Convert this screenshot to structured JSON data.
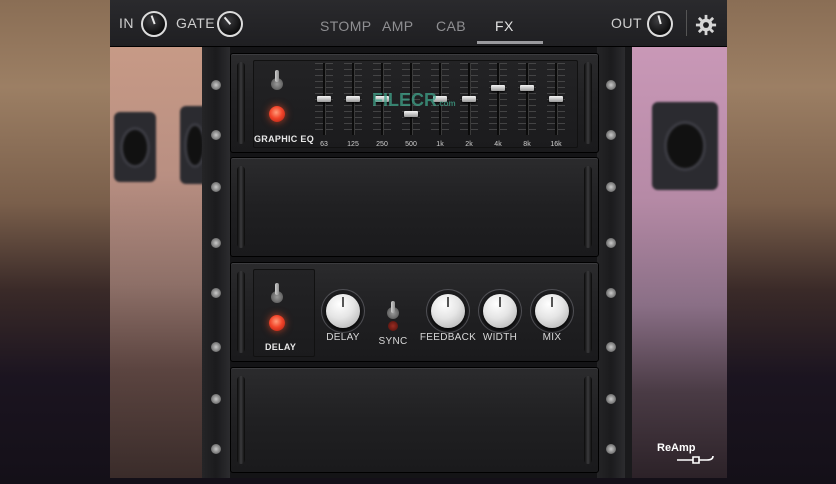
{
  "topbar": {
    "in_label": "IN",
    "gate_label": "GATE",
    "out_label": "OUT",
    "tabs": [
      {
        "label": "STOMP",
        "active": false
      },
      {
        "label": "AMP",
        "active": false
      },
      {
        "label": "CAB",
        "active": false
      },
      {
        "label": "FX",
        "active": true
      }
    ]
  },
  "eq_unit": {
    "label": "GRAPHIC EQ",
    "bands": [
      {
        "freq": "63",
        "level": 0.5
      },
      {
        "freq": "125",
        "level": 0.5
      },
      {
        "freq": "250",
        "level": 0.5
      },
      {
        "freq": "500",
        "level": 0.28
      },
      {
        "freq": "1k",
        "level": 0.5
      },
      {
        "freq": "2k",
        "level": 0.5
      },
      {
        "freq": "4k",
        "level": 0.66
      },
      {
        "freq": "8k",
        "level": 0.66
      },
      {
        "freq": "16k",
        "level": 0.5
      }
    ]
  },
  "delay_unit": {
    "label": "DELAY",
    "knobs": [
      "DELAY",
      "FEEDBACK",
      "WIDTH",
      "MIX"
    ],
    "sync_label": "SYNC"
  },
  "watermark": {
    "text": "FILECR",
    "sub": ".com"
  },
  "brand": {
    "text": "ReAmp"
  },
  "icons": [
    "gear-icon",
    "toggle-switch-icon",
    "led-icon",
    "rack-handle-icon"
  ],
  "colors": {
    "led": "#f2452a",
    "watermark": "#3fa38a",
    "bar": "#1f1f22"
  }
}
